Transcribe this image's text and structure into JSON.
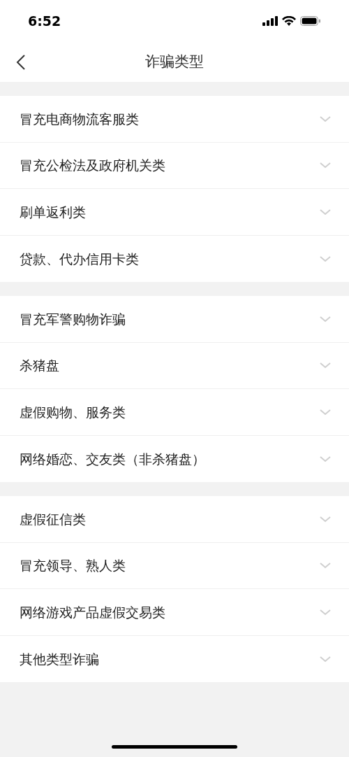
{
  "status_bar": {
    "time": "6:52"
  },
  "nav_bar": {
    "title": "诈骗类型"
  },
  "groups": [
    {
      "items": [
        {
          "label": "冒充电商物流客服类",
          "expanded": false
        },
        {
          "label": "冒充公检法及政府机关类",
          "expanded": false
        },
        {
          "label": "刷单返利类",
          "expanded": false
        },
        {
          "label": "贷款、代办信用卡类",
          "expanded": false
        }
      ]
    },
    {
      "items": [
        {
          "label": "冒充军警购物诈骗",
          "expanded": false
        },
        {
          "label": "杀猪盘",
          "expanded": false
        },
        {
          "label": "虚假购物、服务类",
          "expanded": false
        },
        {
          "label": "网络婚恋、交友类（非杀猪盘）",
          "expanded": false
        }
      ]
    },
    {
      "items": [
        {
          "label": "虚假征信类",
          "expanded": false
        },
        {
          "label": "冒充领导、熟人类",
          "expanded": false
        },
        {
          "label": "网络游戏产品虚假交易类",
          "expanded": false
        },
        {
          "label": "其他类型诈骗",
          "expanded": false
        }
      ]
    }
  ]
}
